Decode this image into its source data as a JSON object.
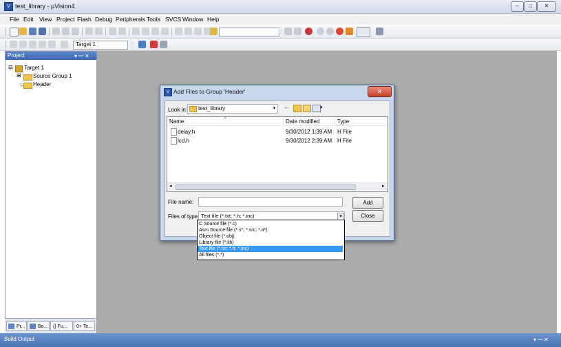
{
  "window": {
    "title": "test_library - µVision4",
    "minimize": "‒",
    "maximize": "□",
    "close": "✕"
  },
  "menu": [
    "File",
    "Edit",
    "View",
    "Project",
    "Flash",
    "Debug",
    "Peripherals",
    "Tools",
    "SVCS",
    "Window",
    "Help"
  ],
  "toolbar2": {
    "target_select": "Target 1"
  },
  "project_panel": {
    "title": "Project",
    "pin": "▾ ꟷ ✕",
    "tree": [
      {
        "label": "Target 1",
        "expander": "⊟"
      },
      {
        "label": "Source Group 1",
        "expander": "⊞"
      },
      {
        "label": "Header",
        "expander": ""
      }
    ],
    "tabs": [
      "Pr...",
      "Bo...",
      "{} Fu...",
      "0+ Te..."
    ]
  },
  "build_output": {
    "title": "Build Output",
    "controls": "▾ ꟷ ✕"
  },
  "dialog": {
    "title": "Add Files to Group 'Header'",
    "close": "✕",
    "look_in_label": "Look in:",
    "look_in_value": "test_library",
    "columns": [
      "Name",
      "Date modified",
      "Type"
    ],
    "files": [
      {
        "name": "delay.h",
        "date": "9/30/2012 1:39 AM",
        "type": "H File"
      },
      {
        "name": "lcd.h",
        "date": "9/30/2012 2:39 AM",
        "type": "H File"
      }
    ],
    "file_name_label": "File name:",
    "file_name_value": "",
    "files_of_type_label": "Files of type:",
    "files_of_type_value": "Text file (*.txt; *.h; *.inc)",
    "add_button": "Add",
    "close_button": "Close",
    "type_options": [
      "C Source file (*.c)",
      "Asm Source file (*.s*; *.src; *.a*)",
      "Object file (*.obj)",
      "Library file (*.lib)",
      "Text file (*.txt; *.h; *.inc)",
      "All files (*.*)"
    ],
    "selected_option_index": 4,
    "colors": {
      "selection": "#3399ff",
      "title_bar": "#c8d7ea"
    }
  }
}
